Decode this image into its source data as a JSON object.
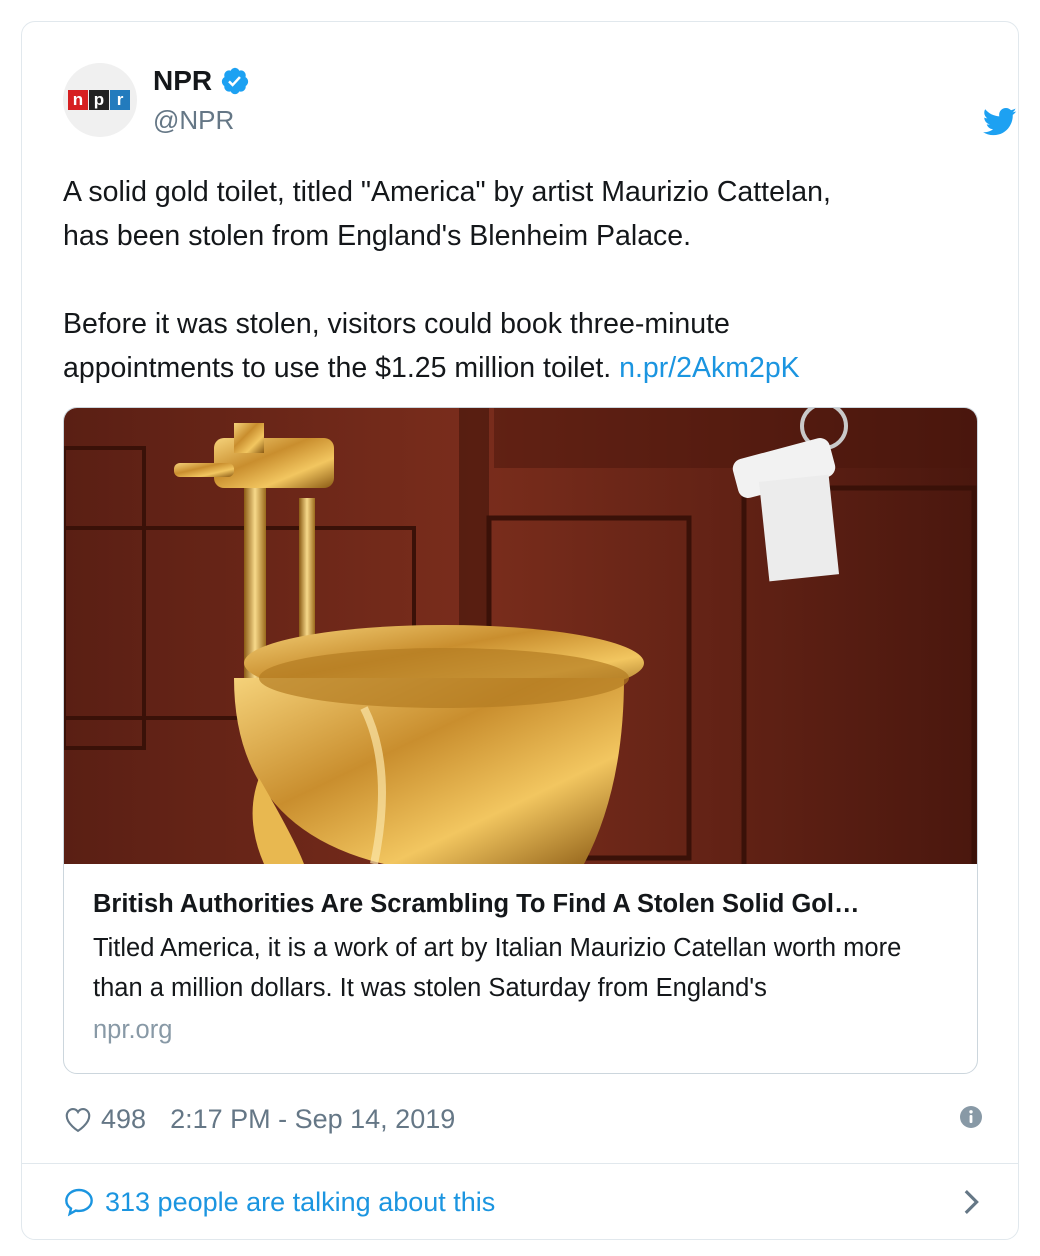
{
  "account": {
    "name": "NPR",
    "handle": "@NPR",
    "logo_letters": [
      "n",
      "p",
      "r"
    ],
    "verified": true,
    "avatar_icon": "npr-logo-icon"
  },
  "tweet": {
    "text_part1": "A solid gold toilet, titled \"America\" by artist Maurizio Cattelan,\nhas been stolen from England's Blenheim Palace.\n\nBefore it was stolen, visitors could book three-minute\nappointments to use the $1.25 million toilet. ",
    "link_text": "n.pr/2Akm2pK"
  },
  "card": {
    "title": "British Authorities Are Scrambling To Find A Stolen Solid Gol…",
    "description": "Titled America, it is a work of art by Italian Maurizio Catellan worth more than a million dollars. It was stolen Saturday from England's",
    "domain": "npr.org"
  },
  "footer": {
    "likes": "498",
    "timestamp": "2:17 PM - Sep 14, 2019",
    "heart_icon": "heart-icon",
    "info_icon": "info-icon"
  },
  "conversation": {
    "label": "313 people are talking about this",
    "bubble_icon": "speech-bubble-icon",
    "chevron_icon": "chevron-right-icon"
  },
  "colors": {
    "link": "#1b95e0",
    "muted": "#657786",
    "border": "#e1e8ed",
    "text": "#14171a"
  }
}
